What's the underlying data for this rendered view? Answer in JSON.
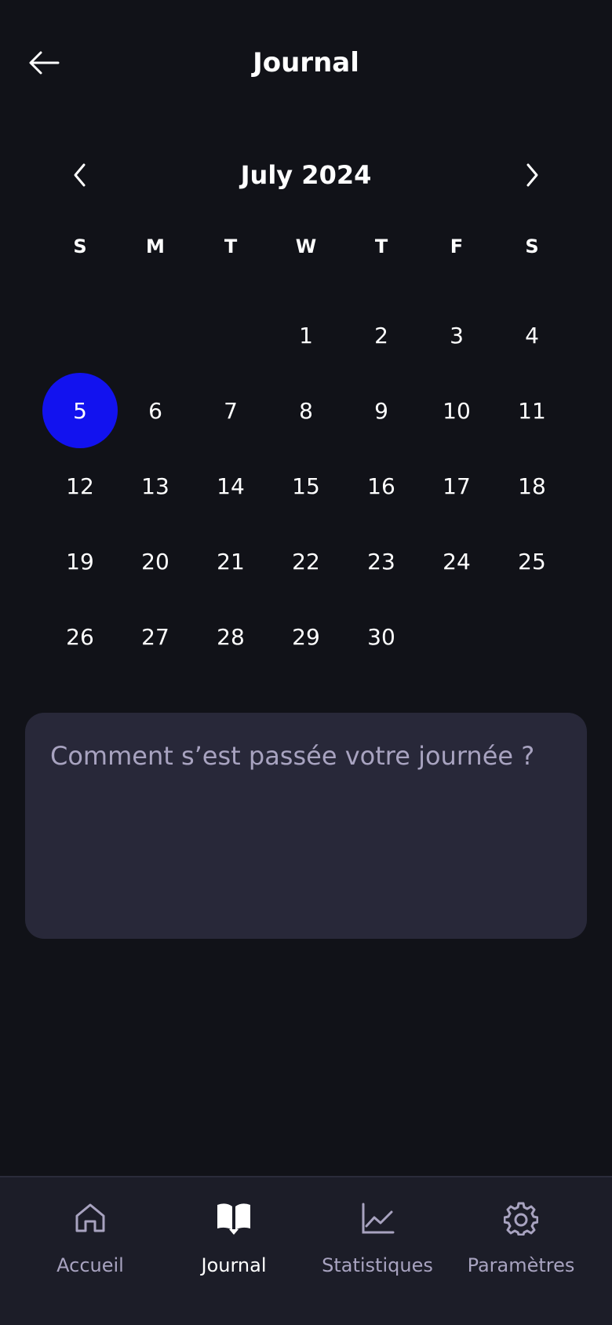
{
  "header": {
    "title": "Journal",
    "back_icon": "arrow-left-icon"
  },
  "calendar": {
    "month_label": "July 2024",
    "prev_icon": "chevron-left-icon",
    "next_icon": "chevron-right-icon",
    "weekdays": [
      "S",
      "M",
      "T",
      "W",
      "T",
      "F",
      "S"
    ],
    "days": [
      "",
      "",
      "",
      "1",
      "2",
      "3",
      "4",
      "5",
      "6",
      "7",
      "8",
      "9",
      "10",
      "11",
      "12",
      "13",
      "14",
      "15",
      "16",
      "17",
      "18",
      "19",
      "20",
      "21",
      "22",
      "23",
      "24",
      "25",
      "26",
      "27",
      "28",
      "29",
      "30",
      "",
      ""
    ],
    "selected_day": "5",
    "selected_color": "#1212ef"
  },
  "journal": {
    "placeholder": "Comment s’est passée votre journée ?",
    "value": ""
  },
  "tabbar": {
    "items": [
      {
        "label": "Accueil",
        "icon": "home-icon",
        "active": false
      },
      {
        "label": "Journal",
        "icon": "book-open-icon",
        "active": true
      },
      {
        "label": "Statistiques",
        "icon": "chart-line-icon",
        "active": false
      },
      {
        "label": "Paramètres",
        "icon": "gear-icon",
        "active": false
      }
    ]
  },
  "colors": {
    "background": "#111218",
    "card": "#282839",
    "tabbar": "#1c1d28",
    "muted_text": "#a8a3c0",
    "accent": "#1212ef"
  }
}
